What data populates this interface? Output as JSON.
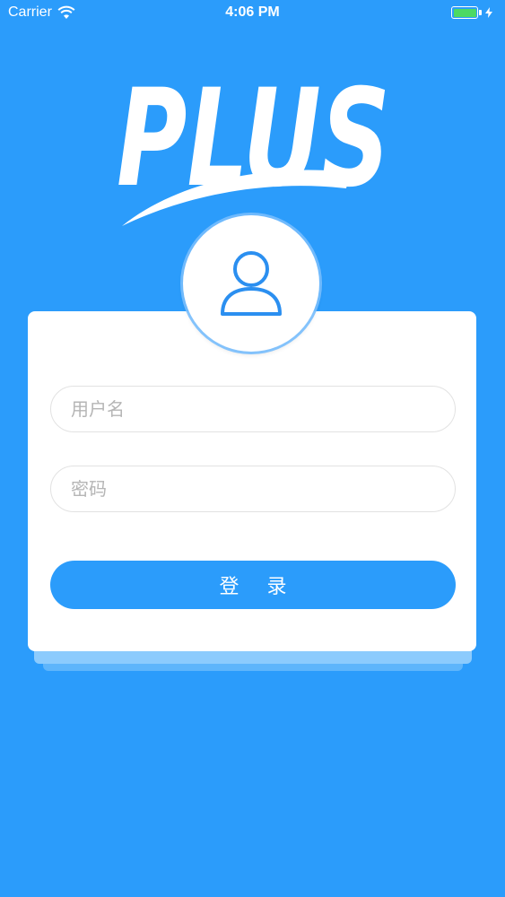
{
  "status_bar": {
    "carrier": "Carrier",
    "time": "4:06 PM",
    "battery_color": "#4cd964"
  },
  "logo": {
    "text": "PLUS"
  },
  "avatar": {
    "icon": "user-icon",
    "icon_color": "#2b8ff0"
  },
  "form": {
    "username_placeholder": "用户名",
    "password_placeholder": "密码",
    "login_label": "登 录"
  },
  "colors": {
    "background": "#2b9cfb",
    "button": "#2b9cfb",
    "card": "#ffffff"
  }
}
